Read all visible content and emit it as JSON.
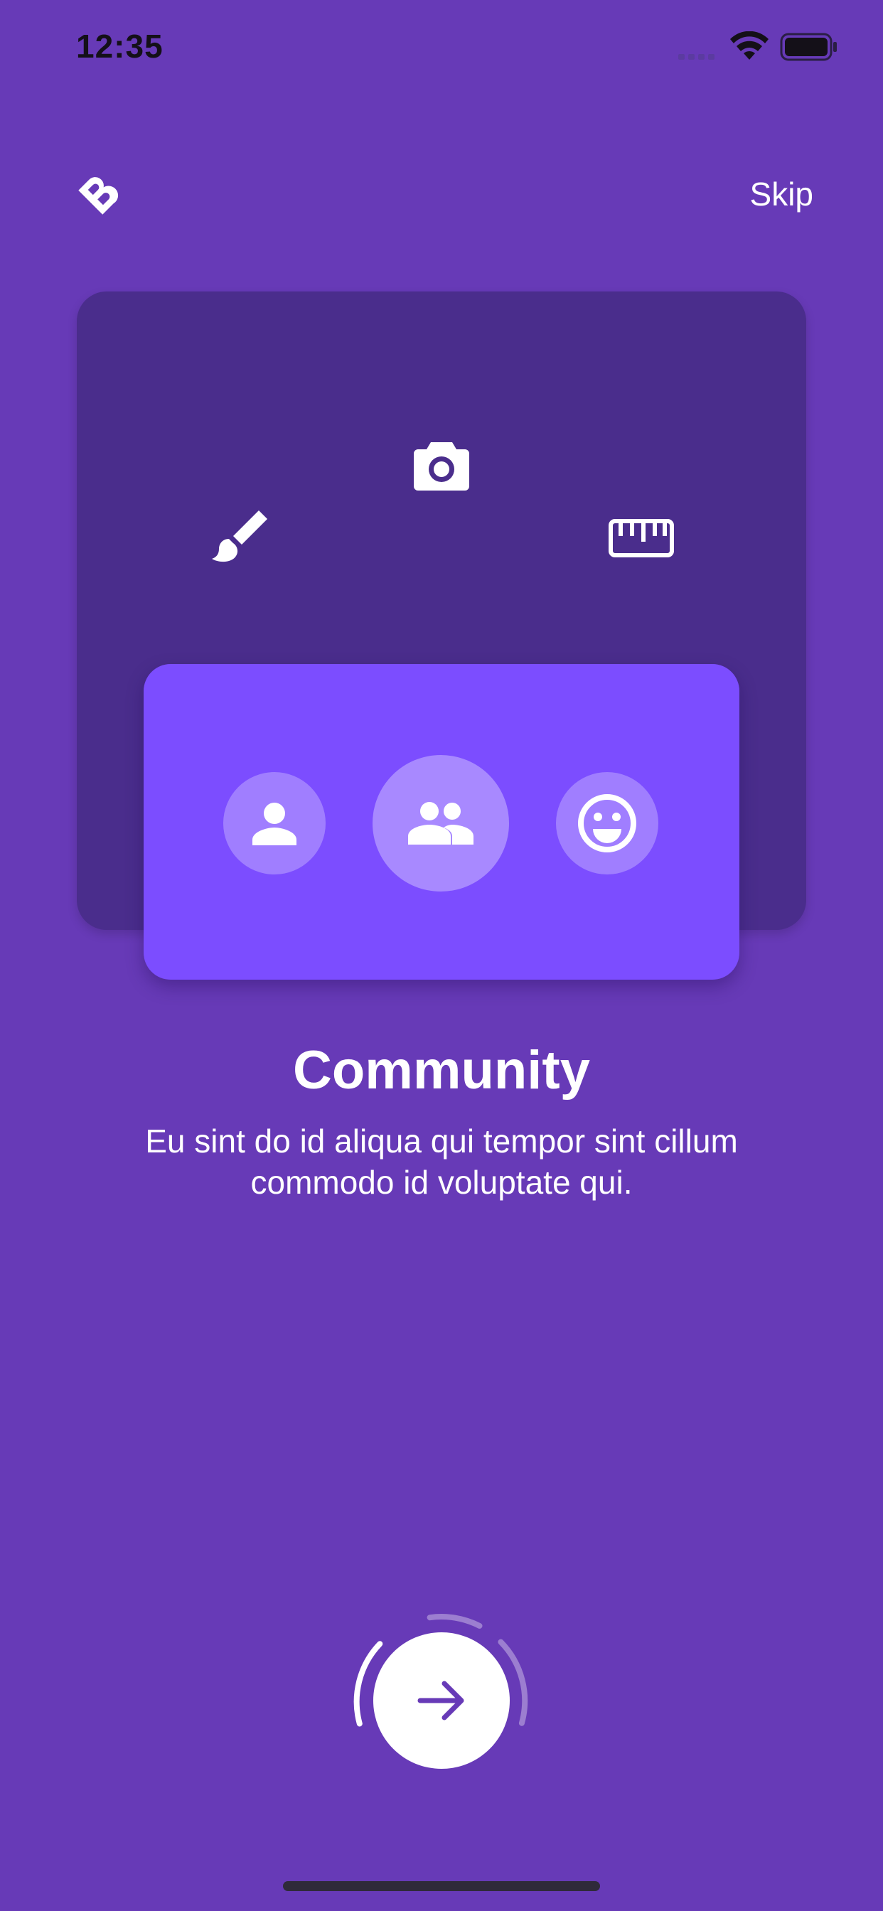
{
  "status_bar": {
    "time": "12:35"
  },
  "header": {
    "skip_label": "Skip"
  },
  "slide": {
    "title": "Community",
    "description": "Eu sint do id aliqua qui tempor sint cillum commodo id voluptate qui."
  },
  "colors": {
    "background": "#673AB7",
    "back_card": "#4A2D8C",
    "front_card": "#7C4DFF",
    "button": "#FFFFFF",
    "accent": "#673AB7"
  },
  "icons": {
    "top": [
      "camera-icon",
      "brush-icon",
      "ruler-icon"
    ],
    "bottom": [
      "person-icon",
      "group-icon",
      "smile-icon"
    ],
    "next": "arrow-right-icon"
  }
}
